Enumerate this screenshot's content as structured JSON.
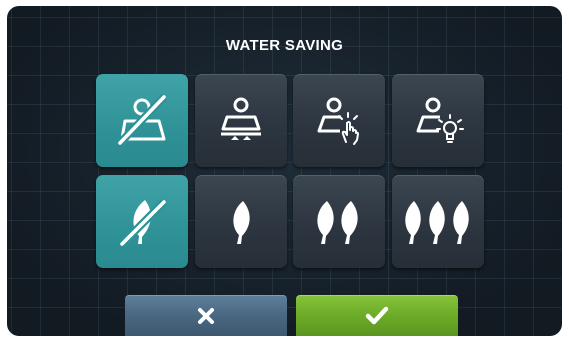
{
  "screen": {
    "title": "WATER SAVING"
  },
  "rows": [
    {
      "name": "detection-mode-row",
      "options": [
        {
          "icon": "no-detection-icon",
          "selected": true
        },
        {
          "icon": "load-weight-icon",
          "selected": false
        },
        {
          "icon": "touch-load-icon",
          "selected": false
        },
        {
          "icon": "load-light-sensor-icon",
          "selected": false
        }
      ]
    },
    {
      "name": "saving-level-row",
      "options": [
        {
          "icon": "no-leaf-icon",
          "level": 0,
          "selected": true
        },
        {
          "icon": "one-leaf-icon",
          "level": 1,
          "selected": false
        },
        {
          "icon": "two-leaves-icon",
          "level": 2,
          "selected": false
        },
        {
          "icon": "three-leaves-icon",
          "level": 3,
          "selected": false
        }
      ]
    }
  ],
  "footer": {
    "cancel_icon": "close-icon",
    "confirm_icon": "checkmark-icon"
  },
  "colors": {
    "selected": "#2e9297",
    "unselected": "#2d3640",
    "cancel": "#4a6781",
    "confirm": "#6cab28"
  }
}
